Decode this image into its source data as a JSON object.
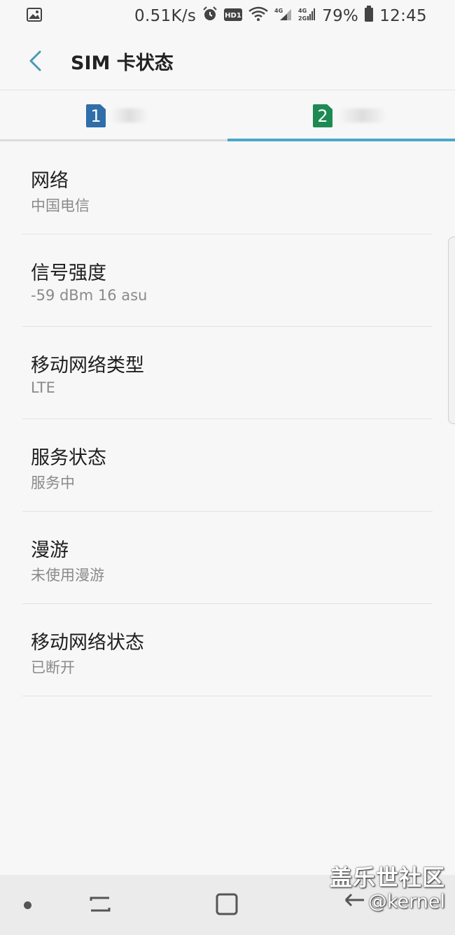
{
  "status_bar": {
    "net_speed": "0.51K/s",
    "hd_label": "HD1",
    "sim1_net": "4G",
    "sim2_net": "4G",
    "sim2_net_alt": "2G",
    "battery": "79%",
    "time": "12:45"
  },
  "header": {
    "title": "SIM 卡状态"
  },
  "tabs": [
    {
      "sim_number": "1",
      "color": "#2f6ea8",
      "selected": false
    },
    {
      "sim_number": "2",
      "color": "#1e8a53",
      "selected": true
    }
  ],
  "accent_color": "#4aa8c8",
  "info": [
    {
      "title": "网络",
      "value": "中国电信"
    },
    {
      "title": "信号强度",
      "value": "-59 dBm 16 asu"
    },
    {
      "title": "移动网络类型",
      "value": "LTE"
    },
    {
      "title": "服务状态",
      "value": "服务中"
    },
    {
      "title": "漫游",
      "value": "未使用漫游"
    },
    {
      "title": "移动网络状态",
      "value": "已断开"
    }
  ],
  "watermark": {
    "line1": "盖乐世社区",
    "line2": "@kernel"
  },
  "icons": [
    "gallery-icon",
    "alarm-icon",
    "hd-icon",
    "wifi-icon",
    "signal-icon",
    "battery-icon",
    "back-arrow-icon",
    "recents-icon",
    "home-icon",
    "back-nav-icon"
  ]
}
